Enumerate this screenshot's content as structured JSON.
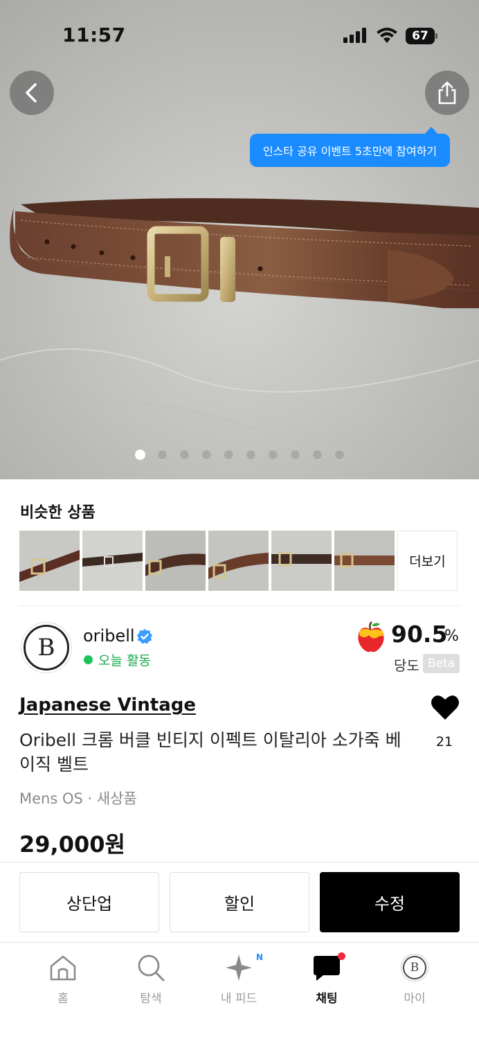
{
  "status_bar": {
    "time": "11:57",
    "battery": "67"
  },
  "hero": {
    "event_tooltip": "인스타 공유 이벤트 5초만에 참여하기",
    "image_count": 10,
    "active_index": 0
  },
  "similar": {
    "title": "비슷한 상품",
    "more_label": "더보기",
    "thumbnail_count": 6
  },
  "seller": {
    "name": "oribell",
    "avatar_text": "B",
    "activity": "오늘 활동",
    "score": "90.5",
    "score_unit": "%",
    "score_label": "당도",
    "beta_label": "Beta"
  },
  "product": {
    "brand": "Japanese Vintage",
    "title": "Oribell 크롬 버클 빈티지 이펙트 이탈리아 소가죽 베이직 벨트",
    "meta": "Mens OS · 새상품",
    "price": "29,000원",
    "likes": "21"
  },
  "actions": {
    "bump": "상단업",
    "discount": "할인",
    "edit": "수정"
  },
  "tabbar": {
    "home": "홈",
    "search": "탐색",
    "feed": "내 피드",
    "feed_badge": "N",
    "chat": "채팅",
    "my": "마이"
  },
  "colors": {
    "accent_blue": "#1a8cff",
    "active_green": "#1ec15a",
    "badge_red": "#f02a3c"
  }
}
